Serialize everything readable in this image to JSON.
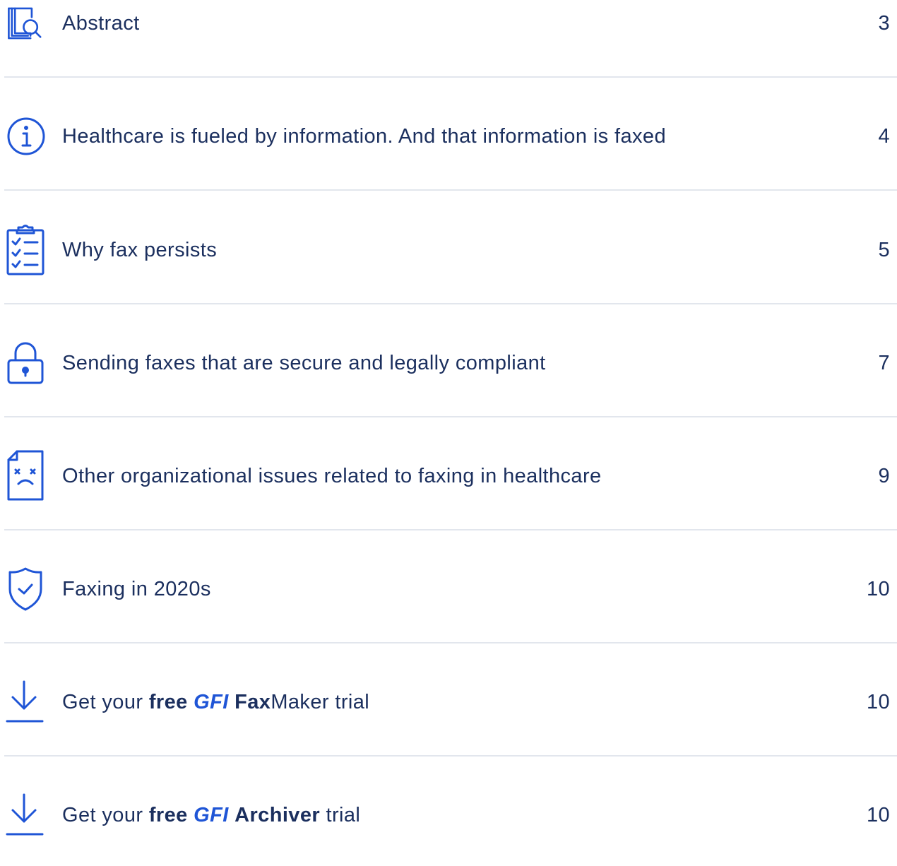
{
  "colors": {
    "icon_blue": "#1f55d6",
    "text_navy": "#1b2f5e",
    "divider": "#e2e6ed",
    "gfi_brand": "#1f55d6"
  },
  "toc": {
    "entries": [
      {
        "icon": "book-search-icon",
        "title": "Abstract",
        "page": "3"
      },
      {
        "icon": "info-icon",
        "title": "Healthcare is fueled by information. And that information is faxed",
        "page": "4"
      },
      {
        "icon": "checklist-icon",
        "title": "Why fax persists",
        "page": "5"
      },
      {
        "icon": "lock-icon",
        "title": "Sending faxes that are secure and legally compliant",
        "page": "7"
      },
      {
        "icon": "sad-document-icon",
        "title": "Other organizational issues related to faxing in healthcare",
        "page": "9"
      },
      {
        "icon": "shield-check-icon",
        "title": "Faxing in 2020s",
        "page": "10"
      },
      {
        "icon": "download-icon",
        "title_parts": {
          "pre": "Get your ",
          "free": "free",
          "gfi": "GFI",
          "product_bold": "Fax",
          "product_rest": "Maker",
          "post": " trial"
        },
        "page": "10"
      },
      {
        "icon": "download-icon",
        "title_parts": {
          "pre": "Get your ",
          "free": "free",
          "gfi": "GFI",
          "product_bold": "Archiver",
          "post": " trial"
        },
        "page": "10"
      }
    ]
  }
}
